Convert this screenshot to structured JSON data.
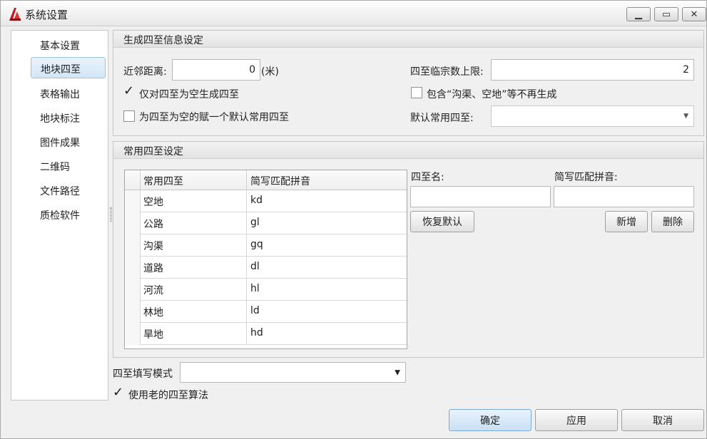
{
  "window": {
    "title": "系统设置"
  },
  "sidebar": {
    "items": [
      {
        "label": "基本设置"
      },
      {
        "label": "地块四至",
        "selected": true
      },
      {
        "label": "表格输出"
      },
      {
        "label": "地块标注"
      },
      {
        "label": "图件成果"
      },
      {
        "label": "二维码"
      },
      {
        "label": "文件路径"
      },
      {
        "label": "质检软件"
      }
    ]
  },
  "generate": {
    "header": "生成四至信息设定",
    "neighbor_label": "近邻距离:",
    "neighbor_value": "0",
    "neighbor_unit": "(米)",
    "limit_label": "四至临宗数上限:",
    "limit_value": "2",
    "only_empty_label": "仅对四至为空生成四至",
    "only_empty_checked": true,
    "include_label": "包含“沟渠、空地”等不再生成",
    "include_checked": false,
    "assign_default_label": "为四至为空的赋一个默认常用四至",
    "assign_default_checked": false,
    "default_label": "默认常用四至:",
    "default_value": ""
  },
  "common": {
    "header": "常用四至设定",
    "columns": [
      "常用四至",
      "简写匹配拼音"
    ],
    "rows": [
      [
        "空地",
        "kd"
      ],
      [
        "公路",
        "gl"
      ],
      [
        "沟渠",
        "gq"
      ],
      [
        "道路",
        "dl"
      ],
      [
        "河流",
        "hl"
      ],
      [
        "林地",
        "ld"
      ],
      [
        "旱地",
        "hd"
      ]
    ],
    "name_label": "四至名:",
    "pinyin_label": "简写匹配拼音:",
    "name_value": "",
    "pinyin_value": "",
    "restore_label": "恢复默认",
    "add_label": "新增",
    "delete_label": "删除"
  },
  "fill_mode": {
    "label": "四至填写模式",
    "value": ""
  },
  "old_algo": {
    "label": "使用老的四至算法",
    "checked": true
  },
  "footer": {
    "ok": "确定",
    "apply": "应用",
    "cancel": "取消"
  },
  "colors": {
    "accent": "#c9e0f5",
    "window_bg": "#f0f0f0"
  }
}
